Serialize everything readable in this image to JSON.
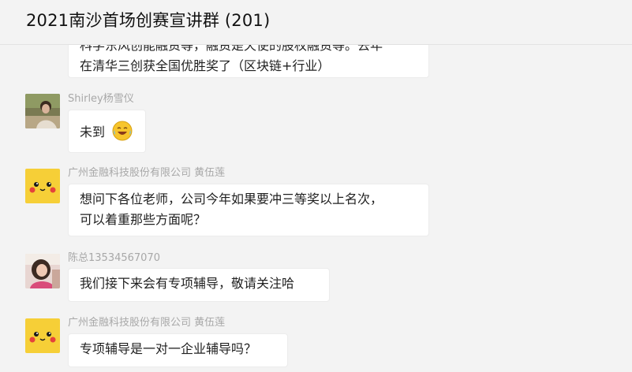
{
  "chat": {
    "title": "2021南沙首场创赛宣讲群 (201)"
  },
  "messages": [
    {
      "lines": [
        "科学东风创能融资等，融资是天使的股权融资等。去年",
        "在清华三创获全国优胜奖了（区块链+行业）"
      ]
    },
    {
      "sender": "Shirley杨雪仪",
      "text": "未到",
      "emoji": "laugh-cry-emoji"
    },
    {
      "sender": "广州金融科技股份有限公司 黄伍莲",
      "lines": [
        "想问下各位老师，公司今年如果要冲三等奖以上名次，",
        "可以着重那些方面呢？"
      ]
    },
    {
      "sender": "陈总13534567070",
      "text": "我们接下来会有专项辅导，敬请关注哈"
    },
    {
      "sender": "广州金融科技股份有限公司 黄伍莲",
      "text": "专项辅导是一对一企业辅导吗？"
    }
  ],
  "colors": {
    "background": "#f3f3f3",
    "bubble": "#ffffff",
    "sender_name": "#a8a8a8",
    "avatar_yellow": "#f6cf37"
  },
  "icons": {
    "avatar_shirley": "portrait-photo",
    "avatar_pikachu": "yellow-cartoon-face",
    "avatar_chen": "portrait-photo"
  }
}
